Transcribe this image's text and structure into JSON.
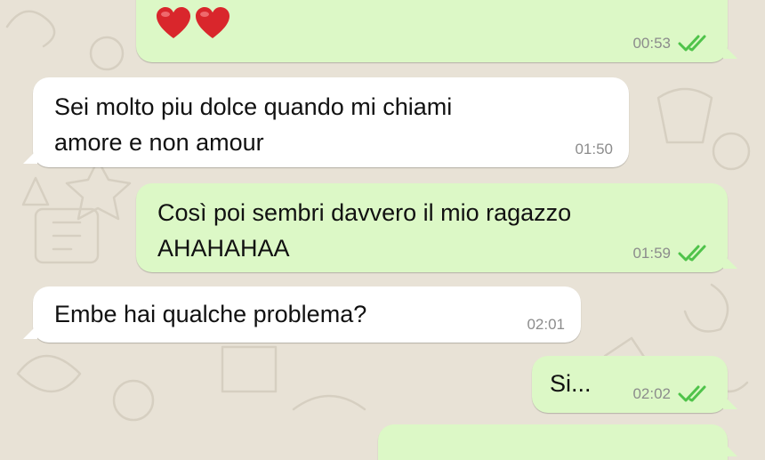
{
  "colors": {
    "background": "#e8e2d6",
    "incoming_bubble": "#ffffff",
    "outgoing_bubble": "#dcf8c6",
    "read_ticks": "#4fc34a",
    "timestamp": "#8c8c8c"
  },
  "messages": [
    {
      "direction": "outgoing",
      "content": "two-red-hearts-emoji",
      "time": "00:53",
      "status": "read"
    },
    {
      "direction": "incoming",
      "lines": [
        "Sei molto piu dolce quando mi chiami",
        "amore e non amour"
      ],
      "time": "01:50"
    },
    {
      "direction": "outgoing",
      "lines": [
        "Così poi sembri davvero il mio ragazzo",
        "AHAHAHAA"
      ],
      "time": "01:59",
      "status": "read"
    },
    {
      "direction": "incoming",
      "lines": [
        "Embe hai qualche problema?"
      ],
      "time": "02:01"
    },
    {
      "direction": "outgoing",
      "lines": [
        "Si..."
      ],
      "time": "02:02",
      "status": "read"
    }
  ]
}
